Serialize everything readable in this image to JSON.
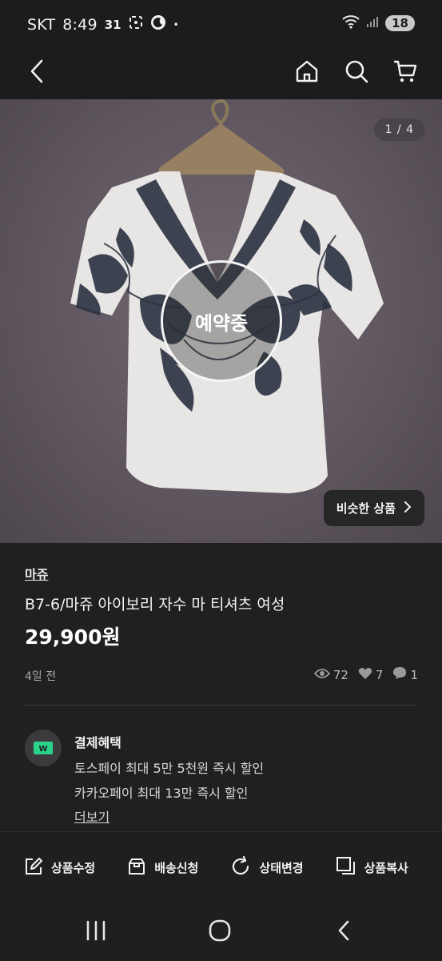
{
  "status_bar": {
    "carrier": "SKT",
    "time": "8:49",
    "temp": "31",
    "dot": "•",
    "battery": "18",
    "icons": [
      "screenshot-icon",
      "do-not-disturb-icon",
      "wifi-icon",
      "signal-icon"
    ]
  },
  "nav": {
    "icons": [
      "back-arrow-icon",
      "home-icon",
      "search-icon",
      "cart-icon"
    ]
  },
  "image": {
    "counter": "1 / 4",
    "reserved_badge": "예약중",
    "similar_button": "비슷한 상품"
  },
  "product": {
    "brand": "마쥬",
    "title": "B7-6/마쥬 아이보리 자수 마 티셔츠 여성",
    "price": "29,900원",
    "time_ago": "4일 전",
    "views": "72",
    "likes": "7",
    "chats": "1"
  },
  "benefits": {
    "title": "결제혜택",
    "line1": "토스페이 최대 5만 5천원 즉시 할인",
    "line2": "카카오페이 최대 13만 즉시 할인",
    "more": "더보기"
  },
  "actions": {
    "edit": "상품수정",
    "shipping": "배송신청",
    "status": "상태변경",
    "copy": "상품복사"
  },
  "colors": {
    "background": "#1f1f21",
    "image_bg": "#5f565f",
    "accent_green": "#2bd38a"
  }
}
